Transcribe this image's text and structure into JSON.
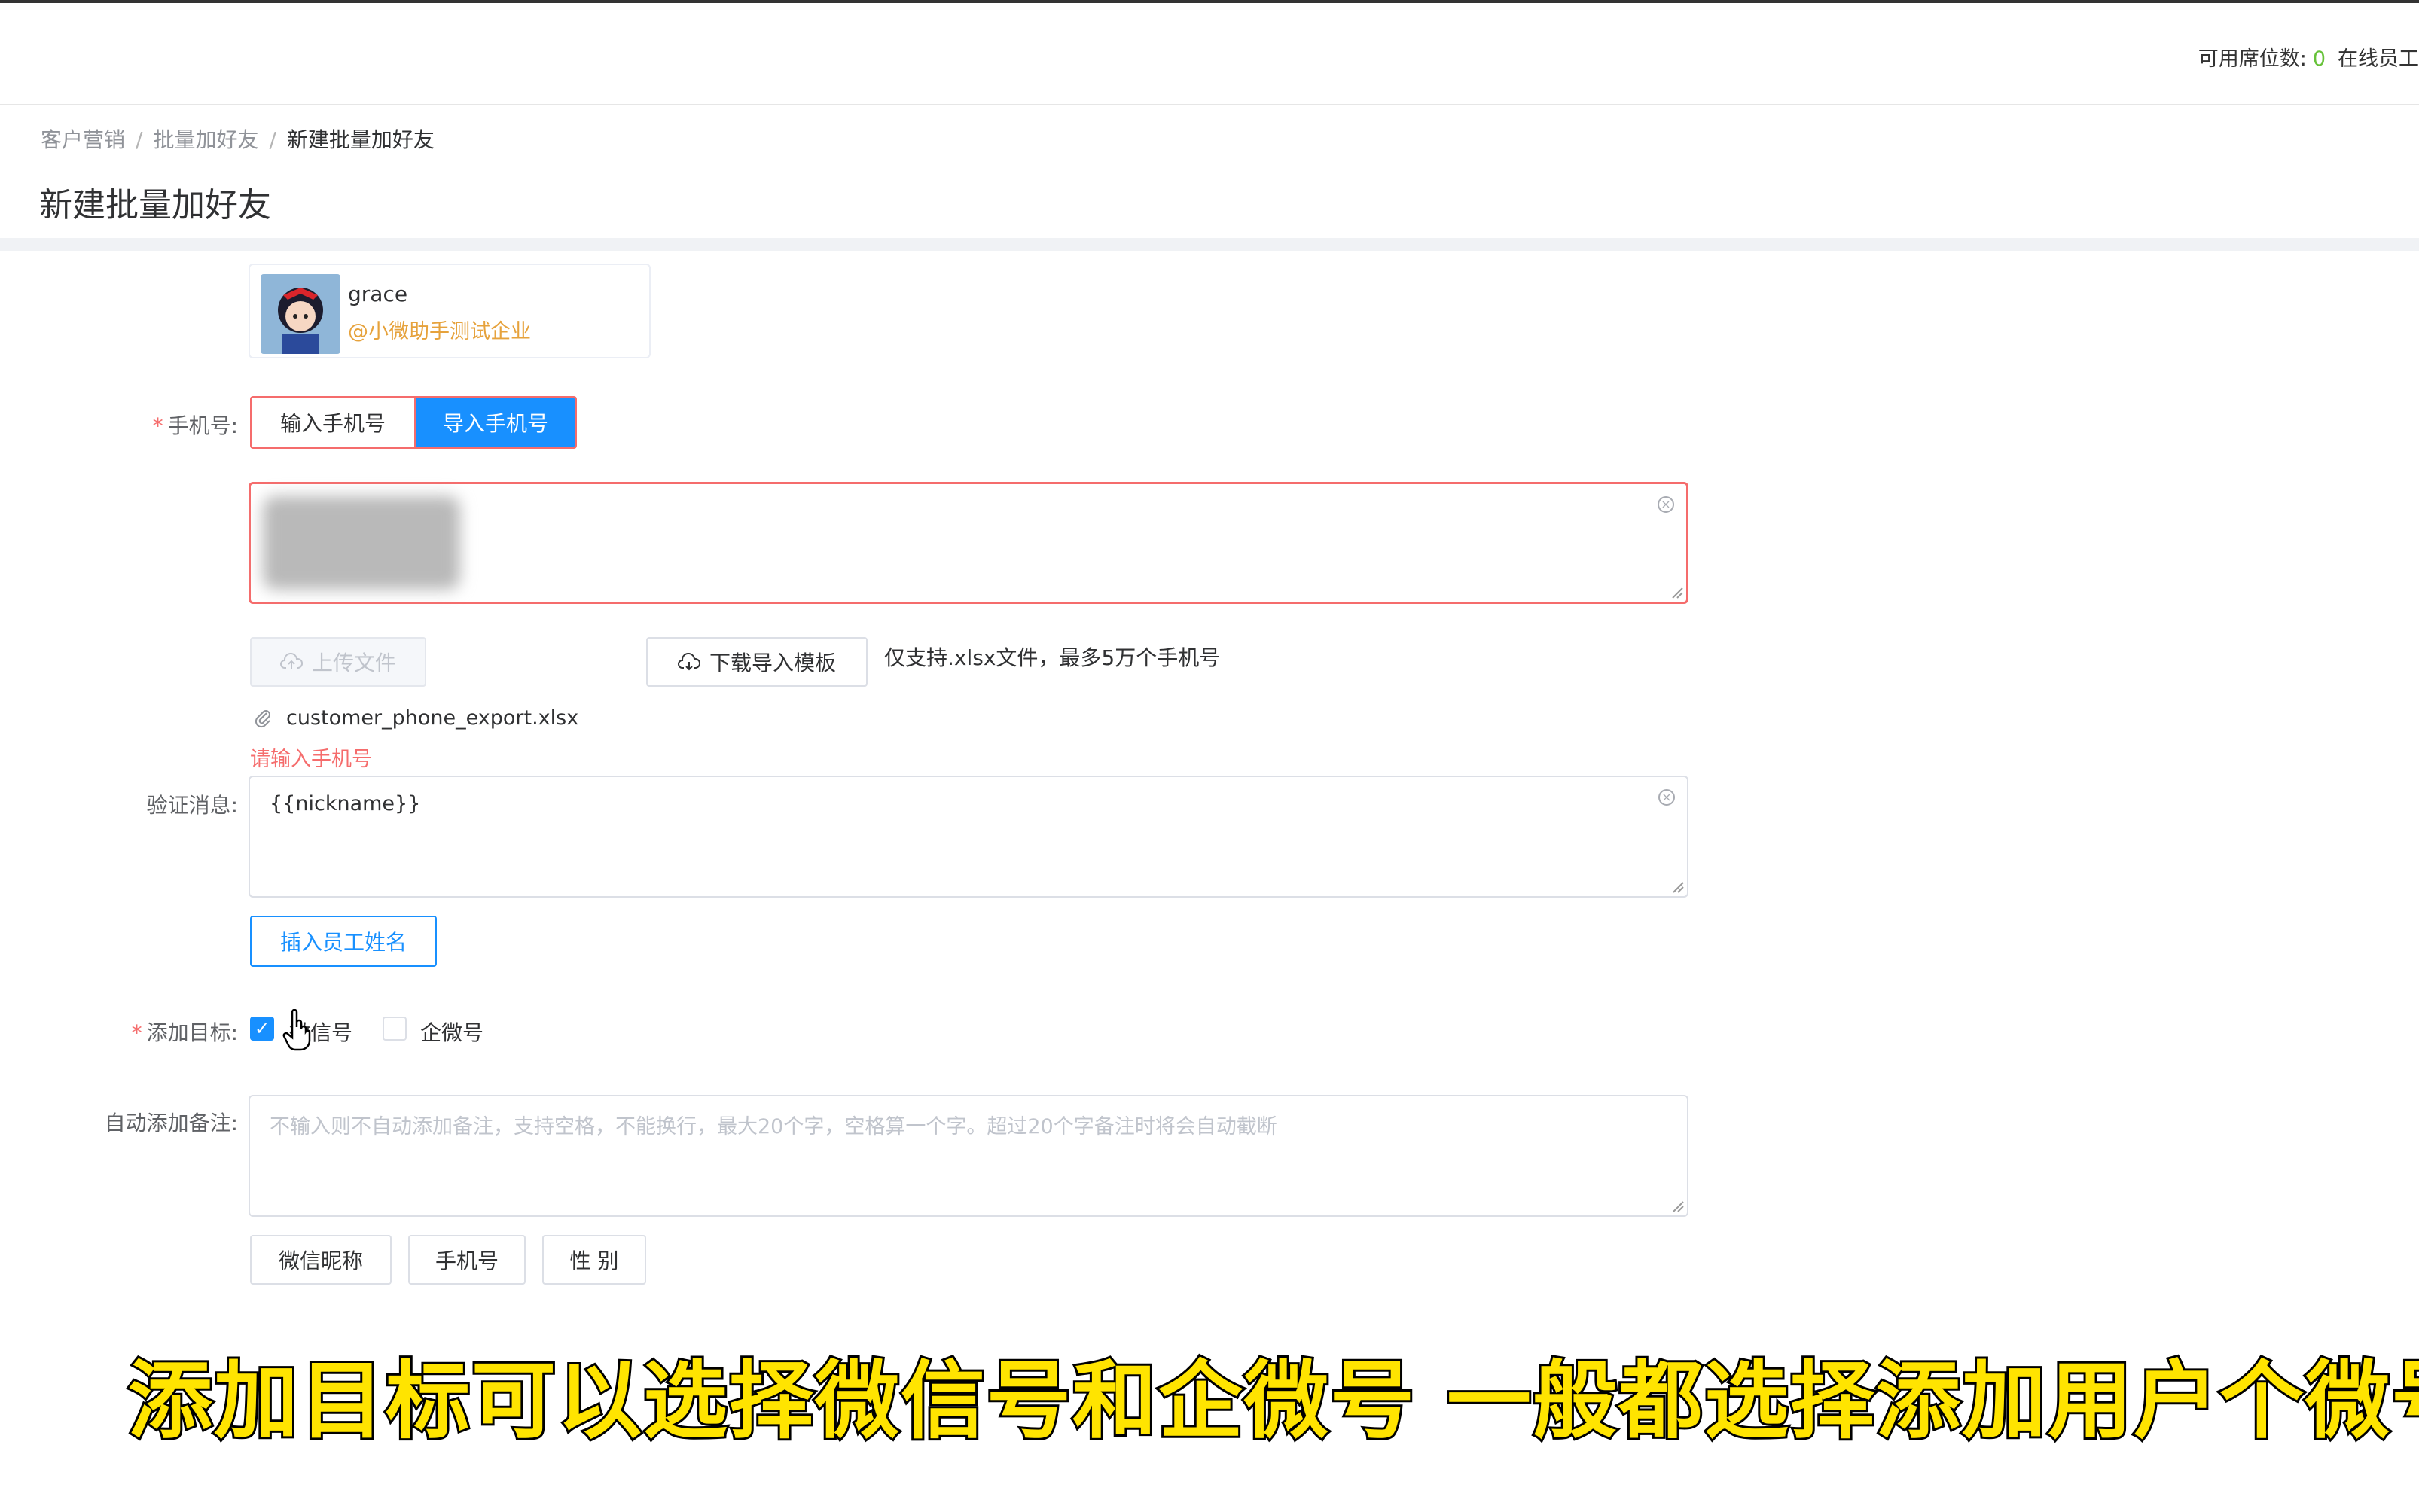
{
  "topbar": {
    "seats_label": "可用席位数:",
    "seats_value": "0",
    "online_label": "在线员工"
  },
  "breadcrumb": {
    "items": [
      "客户营销",
      "批量加好友",
      "新建批量加好友"
    ],
    "separator": "/"
  },
  "page": {
    "title": "新建批量加好友"
  },
  "owner": {
    "name": "grace",
    "corp": "@小微助手测试企业"
  },
  "phone": {
    "label": "手机号:",
    "tabs": [
      "输入手机号",
      "导入手机号"
    ],
    "active_tab": "导入手机号",
    "upload_label": "上传文件",
    "download_label": "下载导入模板",
    "tip": "仅支持.xlsx文件，最多5万个手机号",
    "file_name": "customer_phone_export.xlsx",
    "error": "请输入手机号"
  },
  "verify": {
    "label": "验证消息:",
    "value": "{{nickname}}",
    "insert_label": "插入员工姓名"
  },
  "target": {
    "label": "添加目标:",
    "options": [
      {
        "label": "微信号",
        "checked": true
      },
      {
        "label": "企微号",
        "checked": false
      }
    ]
  },
  "remark": {
    "label": "自动添加备注:",
    "placeholder": "不输入则不自动添加备注，支持空格，不能换行，最大20个字，空格算一个字。超过20个字备注时将会自动截断",
    "tags": [
      "微信昵称",
      "手机号",
      "性 别"
    ]
  },
  "subtitle": "添加目标可以选择微信号和企微号 一般都选择添加用户个微号",
  "colors": {
    "primary": "#1890ff",
    "danger": "#f56c6c",
    "success": "#67c23a",
    "warning": "#e6a23c"
  }
}
